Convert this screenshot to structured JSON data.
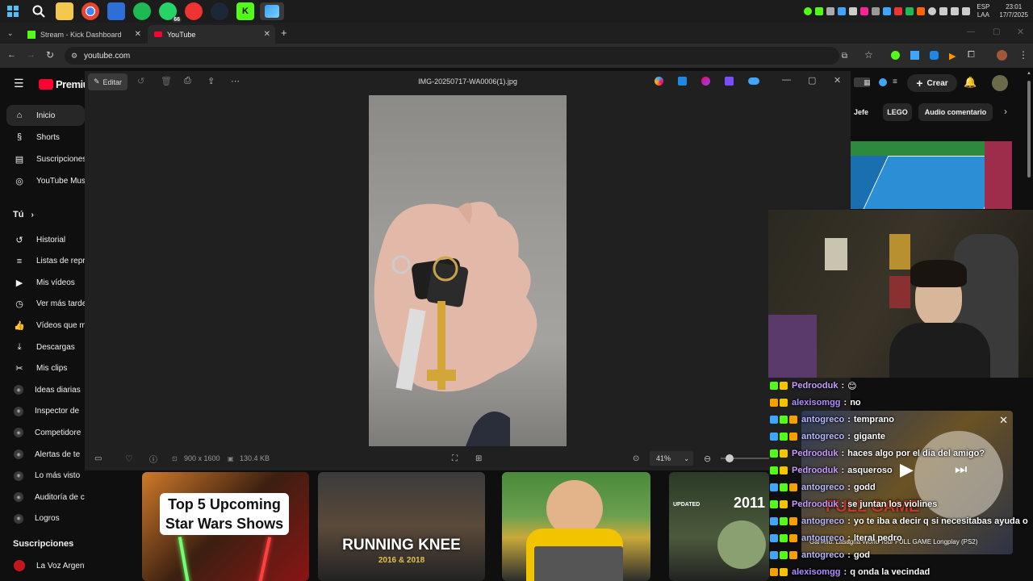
{
  "taskbar": {
    "clock_time": "23:01",
    "clock_date": "17/7/2025",
    "lang_top": "ESP",
    "lang_bottom": "LAA",
    "badge_count": "66"
  },
  "tabs": [
    {
      "label": "Stream - Kick Dashboard",
      "color": "#53fc18"
    },
    {
      "label": "YouTube",
      "color": "#ff0033"
    }
  ],
  "url": "youtube.com",
  "youtube": {
    "logo_text": "Premiu",
    "create_label": "Crear",
    "sidebar": [
      {
        "label": "Inicio",
        "icon": "home-icon",
        "glyph": "⌂",
        "active": true
      },
      {
        "label": "Shorts",
        "icon": "shorts-icon",
        "glyph": "§"
      },
      {
        "label": "Suscripciones",
        "icon": "subscriptions-icon",
        "glyph": "▤"
      },
      {
        "label": "YouTube Mus",
        "icon": "music-icon",
        "glyph": "◎"
      }
    ],
    "you_heading": "Tú",
    "you_items": [
      {
        "label": "Historial",
        "icon": "history-icon",
        "glyph": "↺"
      },
      {
        "label": "Listas de repr",
        "icon": "playlists-icon",
        "glyph": "≡"
      },
      {
        "label": "Mis vídeos",
        "icon": "my-videos-icon",
        "glyph": "▶"
      },
      {
        "label": "Ver más tarde",
        "icon": "watch-later-icon",
        "glyph": "◷"
      },
      {
        "label": "Vídeos que m",
        "icon": "liked-icon",
        "glyph": "👍"
      },
      {
        "label": "Descargas",
        "icon": "download-icon",
        "glyph": "⤓"
      },
      {
        "label": "Mis clips",
        "icon": "clips-icon",
        "glyph": "✂"
      },
      {
        "label": "Ideas diarias",
        "icon": "studio-icon",
        "glyph": "◉"
      },
      {
        "label": "Inspector de",
        "icon": "studio-icon",
        "glyph": "◉"
      },
      {
        "label": "Competidore",
        "icon": "studio-icon",
        "glyph": "◉"
      },
      {
        "label": "Alertas de te",
        "icon": "studio-icon",
        "glyph": "◉"
      },
      {
        "label": "Lo más visto",
        "icon": "studio-icon",
        "glyph": "◉"
      },
      {
        "label": "Auditoría de canal",
        "icon": "studio-icon",
        "glyph": "◉"
      },
      {
        "label": "Logros",
        "icon": "studio-icon",
        "glyph": "◉"
      }
    ],
    "subs_heading": "Suscripciones",
    "subs_items": [
      {
        "label": "La Voz Argentina"
      }
    ],
    "chips": [
      "Jefe",
      "LEGO",
      "Audio comentario"
    ],
    "thumb_texts": {
      "star_wars_line1": "Top 5 Upcoming",
      "star_wars_line2": "Star Wars Shows",
      "wrestling": "RUNNING KNEE",
      "wrestling_sub": "2016 & 2018",
      "updated": "UPDATED",
      "year": "2011"
    }
  },
  "viewer": {
    "edit_label": "Editar",
    "title": "IMG-20250717-WA0006(1).jpg",
    "dimensions": "900 x 1600",
    "filesize": "130.4 KB",
    "zoom": "41%",
    "zoom_fraction": 0.1
  },
  "mini_player": {
    "caption": "Garfield: Lasagna World Tour FULL GAME Longplay (PS2)",
    "overlay_text": "FULL GAME"
  },
  "chat": [
    {
      "user": "Pedrooduk",
      "msg": "😊",
      "color": "#c79bff",
      "badges": [
        "#53fc18",
        "#f5c400"
      ]
    },
    {
      "user": "alexisomgg",
      "msg": "no",
      "color": "#b28cff",
      "badges": [
        "#f5a000",
        "#f5c400"
      ]
    },
    {
      "user": "antogreco",
      "msg": "temprano",
      "color": "#b9b9ff",
      "badges": [
        "#3ea6ff",
        "#53fc18",
        "#f5a000"
      ]
    },
    {
      "user": "antogreco",
      "msg": "gigante",
      "color": "#b9b9ff",
      "badges": [
        "#3ea6ff",
        "#53fc18",
        "#f5a000"
      ]
    },
    {
      "user": "Pedrooduk",
      "msg": "haces algo por el dia del amigo?",
      "color": "#c79bff",
      "badges": [
        "#53fc18",
        "#f5c400"
      ]
    },
    {
      "user": "Pedrooduk",
      "msg": "asqueroso",
      "color": "#c79bff",
      "badges": [
        "#53fc18",
        "#f5c400"
      ]
    },
    {
      "user": "antogreco",
      "msg": "godd",
      "color": "#b9b9ff",
      "badges": [
        "#3ea6ff",
        "#53fc18",
        "#f5a000"
      ]
    },
    {
      "user": "Pedrooduk",
      "msg": "se juntan los violines",
      "color": "#c79bff",
      "badges": [
        "#53fc18",
        "#f5c400"
      ]
    },
    {
      "user": "antogreco",
      "msg": "yo te iba a decir q si necesitabas ayuda o",
      "color": "#b9b9ff",
      "badges": [
        "#3ea6ff",
        "#53fc18",
        "#f5a000"
      ]
    },
    {
      "user": "antogreco",
      "msg": "lteral pedro",
      "color": "#b9b9ff",
      "badges": [
        "#3ea6ff",
        "#53fc18",
        "#f5a000"
      ]
    },
    {
      "user": "antogreco",
      "msg": "god",
      "color": "#b9b9ff",
      "badges": [
        "#3ea6ff",
        "#53fc18",
        "#f5a000"
      ]
    },
    {
      "user": "alexisomgg",
      "msg": "q onda la vecindad",
      "color": "#b28cff",
      "badges": [
        "#f5a000",
        "#f5c400"
      ]
    }
  ]
}
